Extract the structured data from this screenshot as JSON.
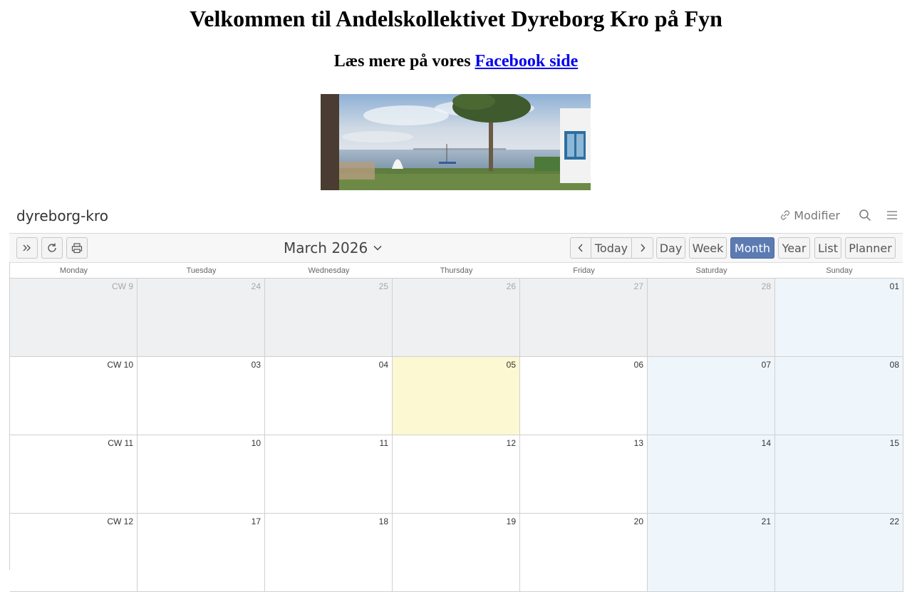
{
  "page": {
    "title": "Velkommen til Andelskollektivet Dyreborg Kro på Fyn",
    "subtitle_prefix": "Læs mere på vores ",
    "subtitle_link": "Facebook side"
  },
  "calendar": {
    "name": "dyreborg-kro",
    "modifier_label": "Modifier",
    "month_title": "March 2026",
    "nav": {
      "today": "Today"
    },
    "views": [
      "Day",
      "Week",
      "Month",
      "Year",
      "List",
      "Planner"
    ],
    "active_view": "Month",
    "weekdays": [
      "Monday",
      "Tuesday",
      "Wednesday",
      "Thursday",
      "Friday",
      "Saturday",
      "Sunday"
    ],
    "weeks": [
      {
        "cw": "CW 9",
        "days": [
          "24",
          "25",
          "26",
          "27",
          "28",
          "01"
        ]
      },
      {
        "cw": "CW 10",
        "days": [
          "03",
          "04",
          "05",
          "06",
          "07",
          "08"
        ]
      },
      {
        "cw": "CW 11",
        "days": [
          "10",
          "11",
          "12",
          "13",
          "14",
          "15"
        ]
      },
      {
        "cw": "CW 12",
        "days": [
          "17",
          "18",
          "19",
          "20",
          "21",
          "22"
        ]
      }
    ]
  },
  "colors": {
    "active_view_bg": "#5b7bb2",
    "today_bg": "#fcf8d2",
    "weekend_bg": "#eff6fb",
    "other_month_bg": "#eff0f2",
    "link": "#0000ee"
  },
  "icons": [
    "fast-forward-icon",
    "refresh-icon",
    "print-icon",
    "chevron-down-icon",
    "chevron-left-icon",
    "chevron-right-icon",
    "link-icon",
    "search-icon",
    "menu-icon"
  ]
}
